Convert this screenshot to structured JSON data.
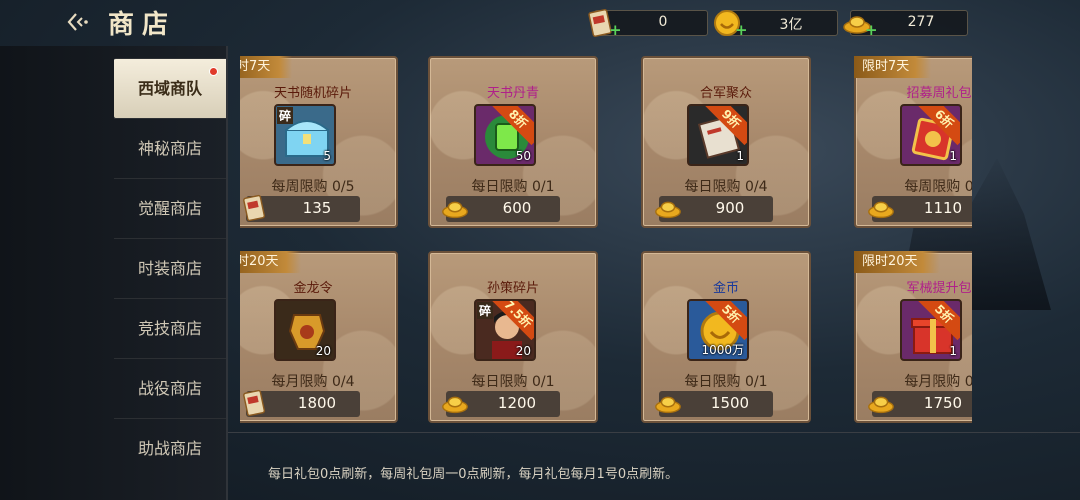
{
  "header": {
    "back_icon": "back-arrow-icon",
    "title": "商店"
  },
  "currencies": [
    {
      "icon": "token-icon",
      "amount": "0"
    },
    {
      "icon": "gold-coin-icon",
      "amount": "3亿"
    },
    {
      "icon": "yuanbao-icon",
      "amount": "277"
    }
  ],
  "sidebar": {
    "items": [
      {
        "label": "西域商队",
        "active": true,
        "badge": true
      },
      {
        "label": "神秘商店"
      },
      {
        "label": "觉醒商店"
      },
      {
        "label": "时装商店"
      },
      {
        "label": "竞技商店"
      },
      {
        "label": "战役商店"
      },
      {
        "label": "助战商店"
      }
    ]
  },
  "shop": {
    "items": [
      {
        "tag": "时7天",
        "name": "天书随机碎片",
        "name_color": "#5a1a0a",
        "fragment_label": "碎",
        "qty": "5",
        "limit": "每周限购 0/5",
        "price": "135",
        "currency": "token-icon",
        "icon": "treasure-chest-icon"
      },
      {
        "name": "天书丹青",
        "name_color": "#b0208a",
        "qty": "50",
        "discount": "8折",
        "limit": "每日限购 0/1",
        "price": "600",
        "currency": "yuanbao-icon",
        "icon": "jade-scroll-icon"
      },
      {
        "name": "合军聚众",
        "name_color": "#5a1a0a",
        "qty": "1",
        "discount": "9折",
        "limit": "每日限购 0/4",
        "price": "900",
        "currency": "yuanbao-icon",
        "icon": "scroll-icon"
      },
      {
        "tag": "限时7天",
        "name": "招募周礼包",
        "name_color": "#b0208a",
        "qty": "1",
        "discount": "6折",
        "limit": "每周限购 0",
        "price": "1110",
        "currency": "yuanbao-icon",
        "icon": "gift-bag-icon"
      },
      {
        "tag": "时20天",
        "name": "金龙令",
        "name_color": "#5a1a0a",
        "qty": "20",
        "limit": "每月限购 0/4",
        "price": "1800",
        "currency": "token-icon",
        "icon": "dragon-token-icon"
      },
      {
        "name": "孙策碎片",
        "name_color": "#5a1a0a",
        "fragment_label": "碎",
        "qty": "20",
        "discount": "7.5折",
        "limit": "每日限购 0/1",
        "price": "1200",
        "currency": "yuanbao-icon",
        "icon": "hero-portrait-icon"
      },
      {
        "name": "金币",
        "name_color": "#1a3a9a",
        "qty": "1000万",
        "discount": "5折",
        "limit": "每日限购 0/1",
        "price": "1500",
        "currency": "yuanbao-icon",
        "icon": "gold-coin-icon"
      },
      {
        "tag": "限时20天",
        "name": "军械提升包",
        "name_color": "#b0208a",
        "qty": "1",
        "discount": "5折",
        "limit": "每月限购 0",
        "price": "1750",
        "currency": "yuanbao-icon",
        "icon": "gift-box-icon"
      }
    ]
  },
  "footer": {
    "note": "每日礼包0点刷新，每周礼包周一0点刷新，每月礼包每月1号0点刷新。"
  },
  "colors": {
    "accent_gold": "#e8b93a",
    "card_bg": "#a6876a",
    "active_tab": "#f4eddc",
    "badge_red": "#e03a2a",
    "discount_orange": "#d44a12"
  }
}
